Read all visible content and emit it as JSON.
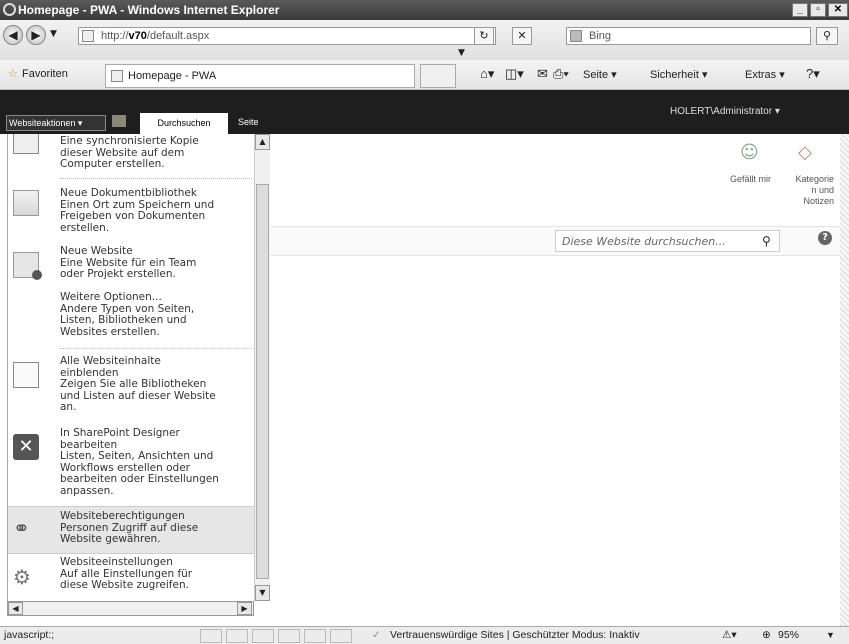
{
  "window": {
    "title": "Homepage - PWA - Windows Internet Explorer"
  },
  "address": {
    "url_prefix": "http://",
    "url_host": "v70",
    "url_path": "/default.aspx",
    "search_placeholder": "Bing"
  },
  "favorites": {
    "label": "Favoriten",
    "tab_title": "Homepage - PWA",
    "commands": [
      "Seite ▾",
      "Sicherheit ▾",
      "Extras ▾"
    ]
  },
  "ribbon": {
    "site_actions": "Websiteaktionen ▾",
    "tab_browse": "Durchsuchen",
    "tab_page": "Seite",
    "user": "HOLERT\\Administrator ▾"
  },
  "menu": {
    "items": [
      {
        "title": "",
        "desc": "Eine synchronisierte Kopie\ndieser Website auf dem\nComputer erstellen."
      },
      {
        "title": "Neue Dokumentbibliothek",
        "desc": "Einen Ort zum Speichern und\nFreigeben von Dokumenten\nerstellen."
      },
      {
        "title": "Neue Website",
        "desc": "Eine Website für ein Team\noder Projekt erstellen."
      },
      {
        "title": "Weitere Optionen...",
        "desc": "Andere Typen von Seiten,\nListen, Bibliotheken und\nWebsites erstellen."
      },
      {
        "title": "Alle Websiteinhalte\neinblenden",
        "desc": "Zeigen Sie alle Bibliotheken\nund Listen auf dieser Website\nan."
      },
      {
        "title": "In SharePoint Designer\nbearbeiten",
        "desc": "Listen, Seiten, Ansichten und\nWorkflows erstellen oder\nbearbeiten oder Einstellungen\nanpassen."
      },
      {
        "title": "Websiteberechtigungen",
        "desc": "Personen Zugriff auf diese\nWebsite gewähren."
      },
      {
        "title": "Websiteeinstellungen",
        "desc": "Auf alle Einstellungen für\ndiese Website zugreifen."
      }
    ]
  },
  "social": {
    "like": "Gefällt mir",
    "tags": "Kategorie\nn und\nNotizen"
  },
  "search": {
    "placeholder": "Diese Website durchsuchen..."
  },
  "status": {
    "left": "javascript:;",
    "zone": "Vertrauenswürdige Sites | Geschützter Modus: Inaktiv",
    "zoom": "95%"
  }
}
